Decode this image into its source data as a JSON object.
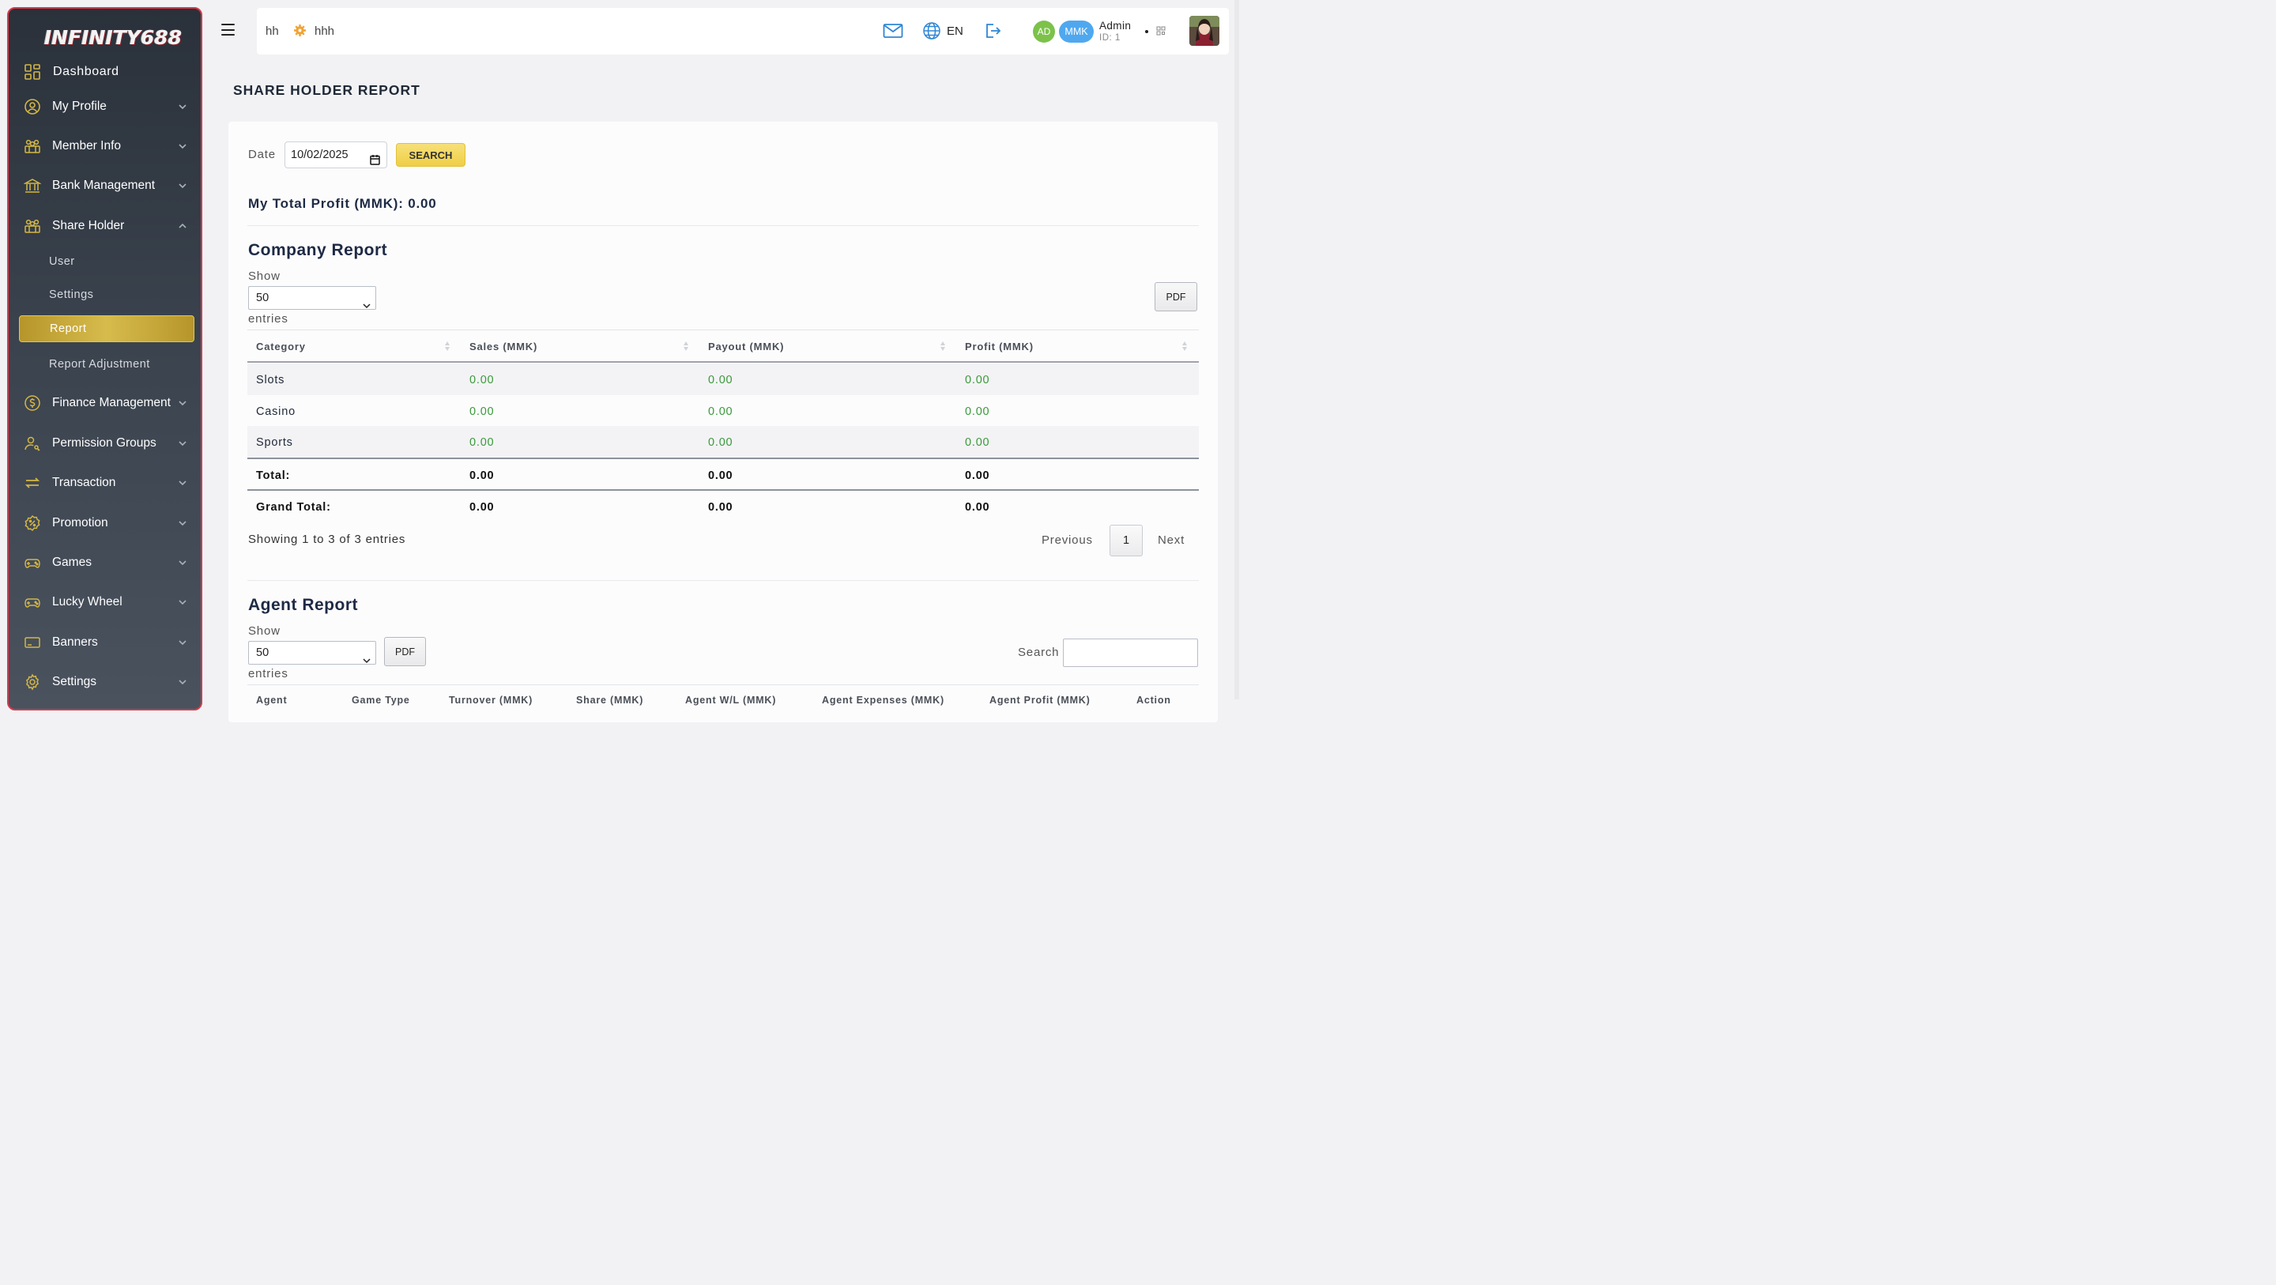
{
  "sidebar": {
    "logo": "INFINITY688",
    "items": [
      {
        "label": "Dashboard"
      },
      {
        "label": "My Profile"
      },
      {
        "label": "Member Info"
      },
      {
        "label": "Bank Management"
      },
      {
        "label": "Share Holder"
      },
      {
        "label": "Finance Management"
      },
      {
        "label": "Permission Groups"
      },
      {
        "label": "Transaction"
      },
      {
        "label": "Promotion"
      },
      {
        "label": "Games"
      },
      {
        "label": "Lucky Wheel"
      },
      {
        "label": "Banners"
      },
      {
        "label": "Settings"
      }
    ],
    "sub_items": [
      "User",
      "Settings",
      "Report",
      "Report Adjustment"
    ],
    "accent_color": "#d4b744"
  },
  "topbar": {
    "crumb_first": "hh",
    "crumb_second": "hhh",
    "language": "EN",
    "badge_ad": "AD",
    "badge_currency": "MMK",
    "user_name": "Admin",
    "user_id": "ID: 1"
  },
  "page": {
    "title": "SHARE HOLDER REPORT",
    "date_label": "Date",
    "date_value": "10/02/2025",
    "search_button": "SEARCH",
    "total_profit": "My Total Profit (MMK): 0.00"
  },
  "company_report": {
    "title": "Company Report",
    "show_label": "Show",
    "entries_value": "50",
    "entries_label": "entries",
    "pdf_button": "PDF",
    "columns": [
      "Category",
      "Sales (MMK)",
      "Payout (MMK)",
      "Profit (MMK)"
    ],
    "rows": [
      {
        "category": "Slots",
        "sales": "0.00",
        "payout": "0.00",
        "profit": "0.00"
      },
      {
        "category": "Casino",
        "sales": "0.00",
        "payout": "0.00",
        "profit": "0.00"
      },
      {
        "category": "Sports",
        "sales": "0.00",
        "payout": "0.00",
        "profit": "0.00"
      }
    ],
    "total": {
      "label": "Total:",
      "sales": "0.00",
      "payout": "0.00",
      "profit": "0.00"
    },
    "grand_total": {
      "label": "Grand Total:",
      "sales": "0.00",
      "payout": "0.00",
      "profit": "0.00"
    },
    "showing": "Showing 1 to 3 of 3 entries",
    "pagination": {
      "previous": "Previous",
      "current": "1",
      "next": "Next"
    }
  },
  "agent_report": {
    "title": "Agent Report",
    "show_label": "Show",
    "entries_value": "50",
    "entries_label": "entries",
    "pdf_button": "PDF",
    "search_label": "Search",
    "columns": [
      "Agent",
      "Game Type",
      "Turnover (MMK)",
      "Share (MMK)",
      "Agent W/L (MMK)",
      "Agent Expenses (MMK)",
      "Agent Profit (MMK)",
      "Action"
    ]
  },
  "colors": {
    "positive_value": "#3a9a3a",
    "sidebar_border": "#d8394a",
    "badge_ad": "#7cc24a",
    "badge_currency": "#4fa8ef",
    "search_button": "#efcf45"
  }
}
